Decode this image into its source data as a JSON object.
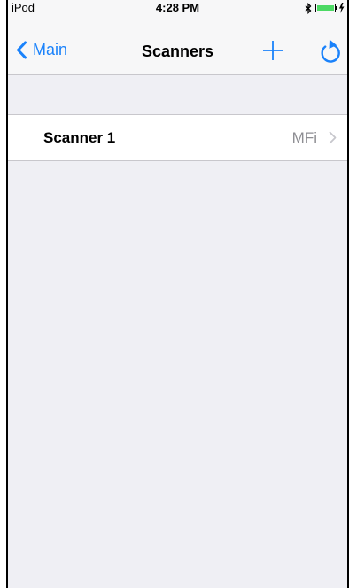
{
  "status_bar": {
    "carrier": "iPod",
    "time": "4:28 PM",
    "bluetooth_icon": "bluetooth-icon",
    "battery_icon": "battery-charging-icon",
    "battery_color": "#4cd964"
  },
  "nav": {
    "back_label": "Main",
    "title": "Scanners",
    "add_icon": "plus-icon",
    "refresh_icon": "refresh-icon",
    "tint_color": "#1a82fb"
  },
  "scanners": [
    {
      "name": "Scanner 1",
      "detail": "MFi"
    }
  ]
}
